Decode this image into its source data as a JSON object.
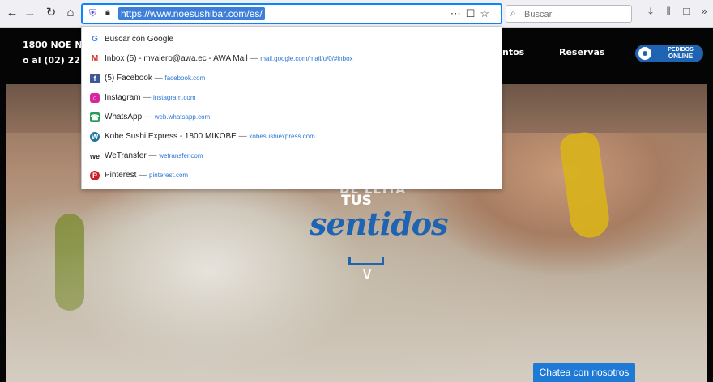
{
  "toolbar": {
    "back_icon": "back-arrow-icon",
    "forward_icon": "forward-arrow-icon",
    "reload_icon": "reload-icon",
    "home_icon": "home-icon",
    "url": "https://www.noesushibar.com/es/",
    "search_placeholder": "Buscar"
  },
  "dropdown": {
    "items": [
      {
        "title": "Buscar con Google",
        "url": "",
        "icon": "google-icon",
        "color": "#ffffff"
      },
      {
        "title": "Inbox (5) - mvalero@awa.ec - AWA Mail",
        "url": "mail.google.com/mail/u/0/#inbox",
        "icon": "gmail-icon",
        "color": "#ffffff"
      },
      {
        "title": "(5) Facebook",
        "url": "facebook.com",
        "icon": "facebook-icon",
        "color": "#3b5998"
      },
      {
        "title": "Instagram",
        "url": "instagram.com",
        "icon": "instagram-icon",
        "color": "#d6249f"
      },
      {
        "title": "WhatsApp",
        "url": "web.whatsapp.com",
        "icon": "whatsapp-icon",
        "color": "#2a9d55"
      },
      {
        "title": "Kobe Sushi Express - 1800 MIKOBE",
        "url": "kobesushiexpress.com",
        "icon": "wordpress-icon",
        "color": "#21759b"
      },
      {
        "title": "WeTransfer",
        "url": "wetransfer.com",
        "icon": "wetransfer-icon",
        "color": "#ffffff"
      },
      {
        "title": "Pinterest",
        "url": "pinterest.com",
        "icon": "pinterest-icon",
        "color": "#cb2027"
      }
    ]
  },
  "site": {
    "info_line1": "1800 NOE NOE (6",
    "info_line2": "o al (02) 2210800",
    "nav_partial": "ntos",
    "nav_reservas": "Reservas",
    "pedidos_line1": "PEDIDOS",
    "pedidos_line2": "ONLINE",
    "slogan_top": "DE LEITA",
    "slogan_mid": "TUS",
    "slogan_script": "sentidos",
    "chat_label": "Chatea con nosotros"
  }
}
